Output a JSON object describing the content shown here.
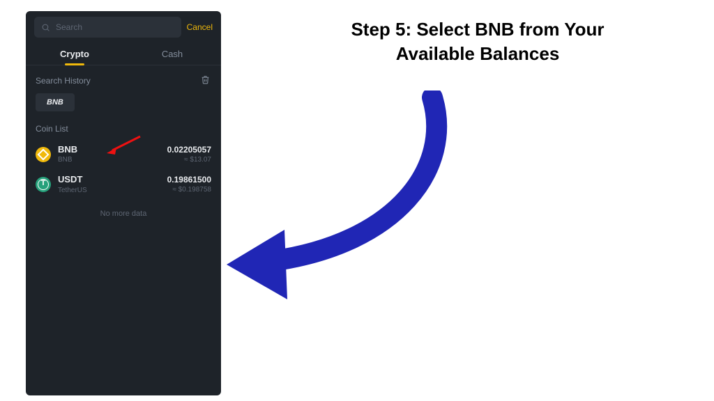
{
  "instruction": {
    "line1": "Step 5: Select BNB from Your",
    "line2": "Available Balances"
  },
  "search": {
    "placeholder": "Search",
    "cancel": "Cancel"
  },
  "tabs": {
    "crypto": "Crypto",
    "cash": "Cash"
  },
  "history": {
    "label": "Search History",
    "chip": "BNB"
  },
  "coinlist": {
    "label": "Coin List",
    "items": [
      {
        "symbol": "BNB",
        "name": "BNB",
        "amount": "0.02205057",
        "fiat": "≈ $13.07"
      },
      {
        "symbol": "USDT",
        "name": "TetherUS",
        "amount": "0.19861500",
        "fiat": "≈ $0.198758"
      }
    ],
    "no_more": "No more data"
  }
}
